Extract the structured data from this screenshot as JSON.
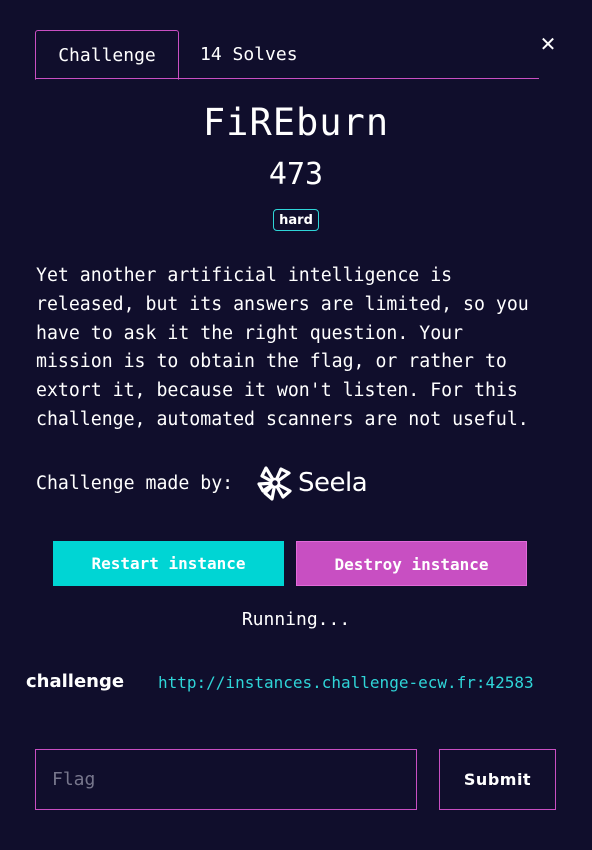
{
  "tabs": {
    "challenge_label": "Challenge",
    "solves_label": "14 Solves"
  },
  "close_icon": "close-icon",
  "challenge": {
    "name": "FiREburn",
    "value": "473",
    "difficulty": "hard",
    "description": "Yet another artificial intelligence is\nreleased, but its answers are limited, so you\nhave to ask it the right question. Your\nmission is to obtain the flag, or rather to\nextort it, because it won't listen. For this\nchallenge, automated scanners are not useful.",
    "author_label": "Challenge made by: ",
    "author_name": "Seela"
  },
  "instance": {
    "restart_label": "Restart instance",
    "destroy_label": "Destroy instance",
    "status": "Running...",
    "connection_label": "challenge",
    "connection_url": "http://instances.challenge-ecw.fr:42583"
  },
  "submission": {
    "placeholder": "Flag",
    "value": "",
    "submit_label": "Submit"
  },
  "colors": {
    "background": "#100e2c",
    "accent_pink": "#c84fc2",
    "accent_cyan": "#00d5d4",
    "link": "#2fd5d8"
  }
}
